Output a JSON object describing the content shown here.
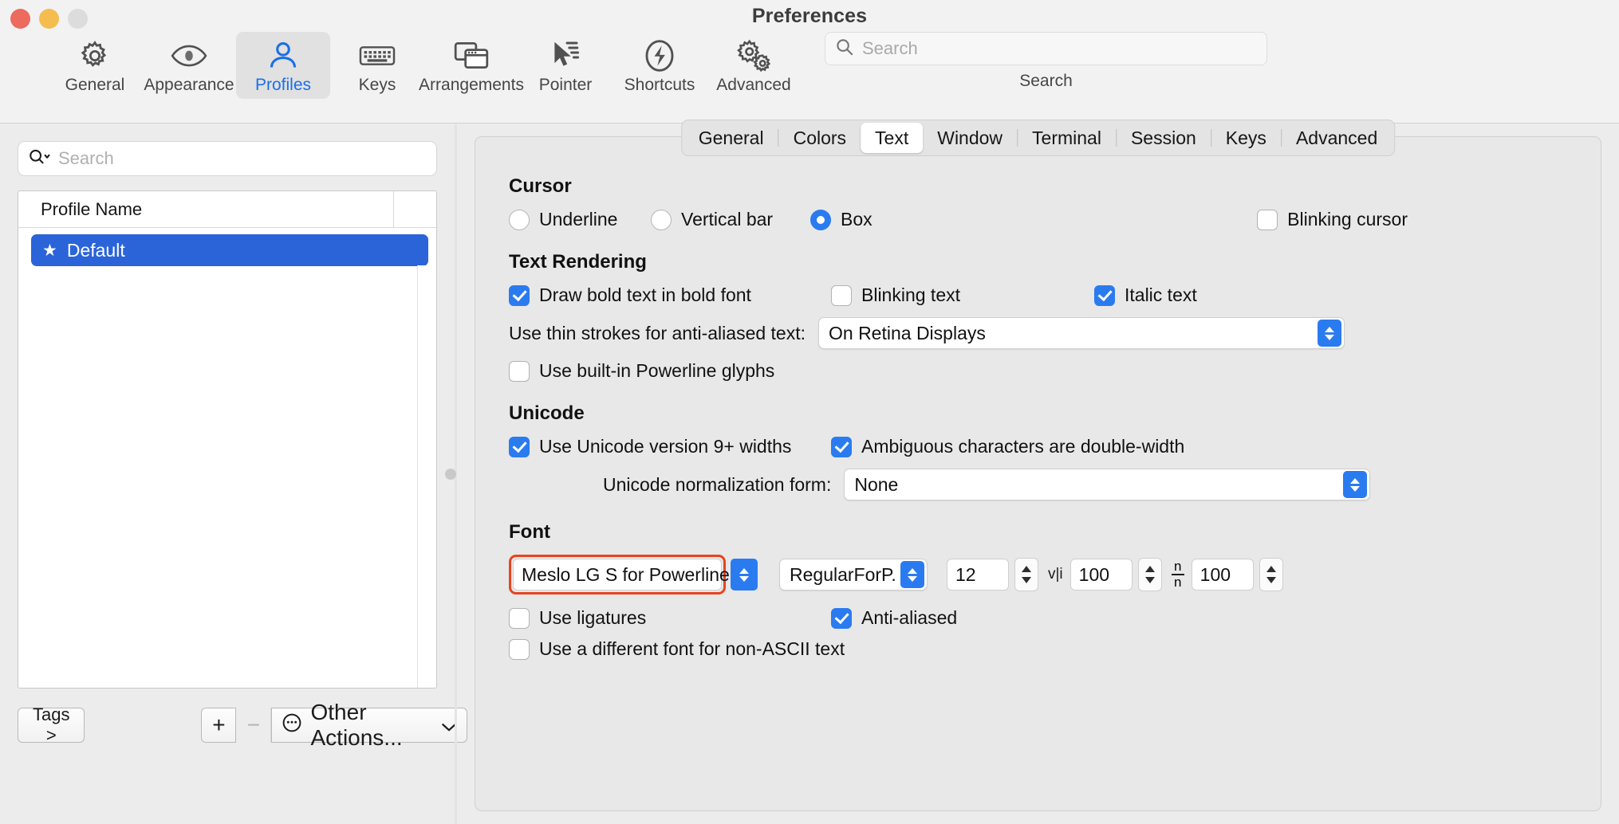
{
  "window": {
    "title": "Preferences"
  },
  "toolbar": {
    "items": [
      {
        "label": "General",
        "icon": "gear-icon",
        "selected": false
      },
      {
        "label": "Appearance",
        "icon": "eye-icon",
        "selected": false
      },
      {
        "label": "Profiles",
        "icon": "person-icon",
        "selected": true
      },
      {
        "label": "Keys",
        "icon": "keyboard-icon",
        "selected": false
      },
      {
        "label": "Arrangements",
        "icon": "windows-icon",
        "selected": false
      },
      {
        "label": "Pointer",
        "icon": "cursor-icon",
        "selected": false
      },
      {
        "label": "Shortcuts",
        "icon": "bolt-icon",
        "selected": false
      },
      {
        "label": "Advanced",
        "icon": "gears-icon",
        "selected": false
      }
    ],
    "search": {
      "placeholder": "Search",
      "value": "",
      "caption": "Search",
      "icon": "search-icon"
    }
  },
  "sidebar": {
    "search": {
      "placeholder": "Search",
      "value": "",
      "icon": "search-scope-icon"
    },
    "table": {
      "column_header": "Profile Name",
      "rows": [
        {
          "name": "Default",
          "starred": true,
          "star_glyph": "★",
          "selected": true
        }
      ]
    },
    "bottom": {
      "tags_label": "Tags >",
      "add_label": "+",
      "remove_label": "−",
      "other_actions_label": "Other Actions...",
      "other_actions_icon": "ellipsis-circle-icon"
    }
  },
  "main": {
    "tabs": [
      {
        "label": "General",
        "selected": false
      },
      {
        "label": "Colors",
        "selected": false
      },
      {
        "label": "Text",
        "selected": true
      },
      {
        "label": "Window",
        "selected": false
      },
      {
        "label": "Terminal",
        "selected": false
      },
      {
        "label": "Session",
        "selected": false
      },
      {
        "label": "Keys",
        "selected": false
      },
      {
        "label": "Advanced",
        "selected": false
      }
    ],
    "cursor": {
      "title": "Cursor",
      "options": [
        {
          "label": "Underline",
          "selected": false
        },
        {
          "label": "Vertical bar",
          "selected": false
        },
        {
          "label": "Box",
          "selected": true
        }
      ],
      "blinking_cursor": {
        "label": "Blinking cursor",
        "checked": false
      }
    },
    "text_rendering": {
      "title": "Text Rendering",
      "draw_bold": {
        "label": "Draw bold text in bold font",
        "checked": true
      },
      "blinking_text": {
        "label": "Blinking text",
        "checked": false
      },
      "italic_text": {
        "label": "Italic text",
        "checked": true
      },
      "thin_strokes": {
        "label": "Use thin strokes for anti-aliased text:",
        "value": "On Retina Displays"
      },
      "powerline": {
        "label": "Use built-in Powerline glyphs",
        "checked": false
      }
    },
    "unicode": {
      "title": "Unicode",
      "version9": {
        "label": "Use Unicode version 9+ widths",
        "checked": true
      },
      "ambiguous": {
        "label": "Ambiguous characters are double-width",
        "checked": true
      },
      "normalization": {
        "label": "Unicode normalization form:",
        "value": "None"
      }
    },
    "font": {
      "title": "Font",
      "family": "Meslo LG S for Powerline",
      "style": "RegularForP...",
      "size": "12",
      "horizontal_spacing": "100",
      "horizontal_spacing_icon": "v|i",
      "vertical_spacing": "100",
      "vertical_spacing_icon": "n-over-n",
      "ligatures": {
        "label": "Use ligatures",
        "checked": false
      },
      "antialiased": {
        "label": "Anti-aliased",
        "checked": true
      },
      "non_ascii": {
        "label": "Use a different font for non-ASCII text",
        "checked": false
      },
      "highlight_color": "#e8431f"
    }
  }
}
